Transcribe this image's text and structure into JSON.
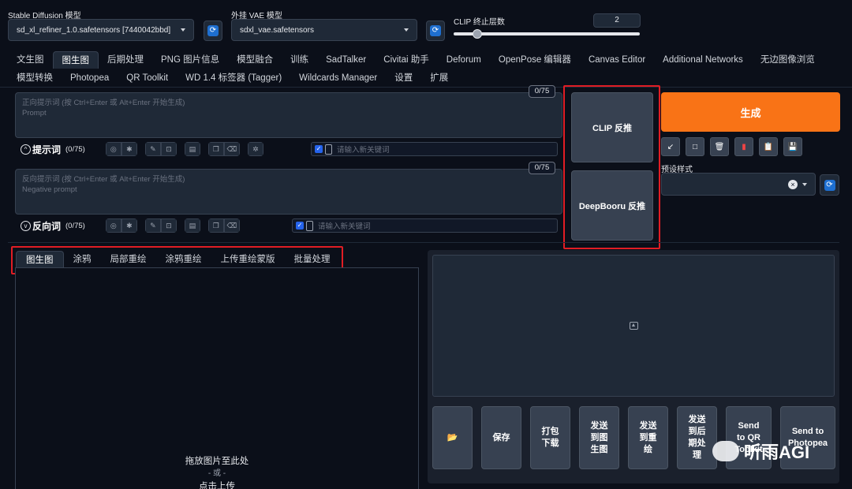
{
  "settings": {
    "sd_model_label": "Stable Diffusion 模型",
    "sd_model_value": "sd_xl_refiner_1.0.safetensors [7440042bbd]",
    "vae_label": "外挂 VAE 模型",
    "vae_value": "sdxl_vae.safetensors",
    "clip_label": "CLIP 终止层数",
    "clip_value": "2",
    "clip_slider_fraction": 0.05
  },
  "main_tabs_row1": [
    "文生图",
    "图生图",
    "后期处理",
    "PNG 图片信息",
    "模型融合",
    "训练",
    "SadTalker",
    "Civitai 助手",
    "Deforum",
    "OpenPose 编辑器",
    "Canvas Editor",
    "Additional Networks",
    "无边图像浏览"
  ],
  "main_tabs_row2": [
    "模型转换",
    "Photopea",
    "QR Toolkit",
    "WD 1.4 标签器 (Tagger)",
    "Wildcards Manager",
    "设置",
    "扩展"
  ],
  "selected_main_tab": "图生图",
  "prompt": {
    "placeholder_line1": "正向提示词 (按 Ctrl+Enter 或 Alt+Enter 开始生成)",
    "placeholder_line2": "Prompt",
    "counter": "0/75",
    "label": "提示词",
    "label_count": "(0/75)",
    "keyword_placeholder": "请输入新关键词"
  },
  "negative": {
    "placeholder_line1": "反向提示词 (按 Ctrl+Enter 或 Alt+Enter 开始生成)",
    "placeholder_line2": "Negative prompt",
    "counter": "0/75",
    "label": "反向词",
    "label_count": "(0/75)",
    "keyword_placeholder": "请输入新关键词"
  },
  "interrogate": {
    "clip_button": "CLIP 反推",
    "deepbooru_button": "DeepBooru 反推"
  },
  "generate_button": "生成",
  "styles_label": "预设样式",
  "sub_tabs": [
    "图生图",
    "涂鸦",
    "局部重绘",
    "涂鸦重绘",
    "上传重绘蒙版",
    "批量处理"
  ],
  "upload": {
    "line1": "拖放图片至此处",
    "line2": "- 或 -",
    "line3": "点击上传"
  },
  "output_buttons": [
    {
      "label": "📂"
    },
    {
      "label": "保存"
    },
    {
      "label": "打包\n下载"
    },
    {
      "label": "发送\n到图\n生图"
    },
    {
      "label": "发送\n到重\n绘"
    },
    {
      "label": "发送\n到后\n期处\n理"
    },
    {
      "label": "Send\nto QR\nToolkit"
    },
    {
      "label": "Send to\nPhotopea"
    }
  ],
  "watermark": "听雨AGI",
  "colors": {
    "background": "#0b0f19",
    "panel": "#1f2937",
    "accent_orange": "#f97316",
    "highlight_red": "#e11d24",
    "checkbox_blue": "#2563eb"
  }
}
